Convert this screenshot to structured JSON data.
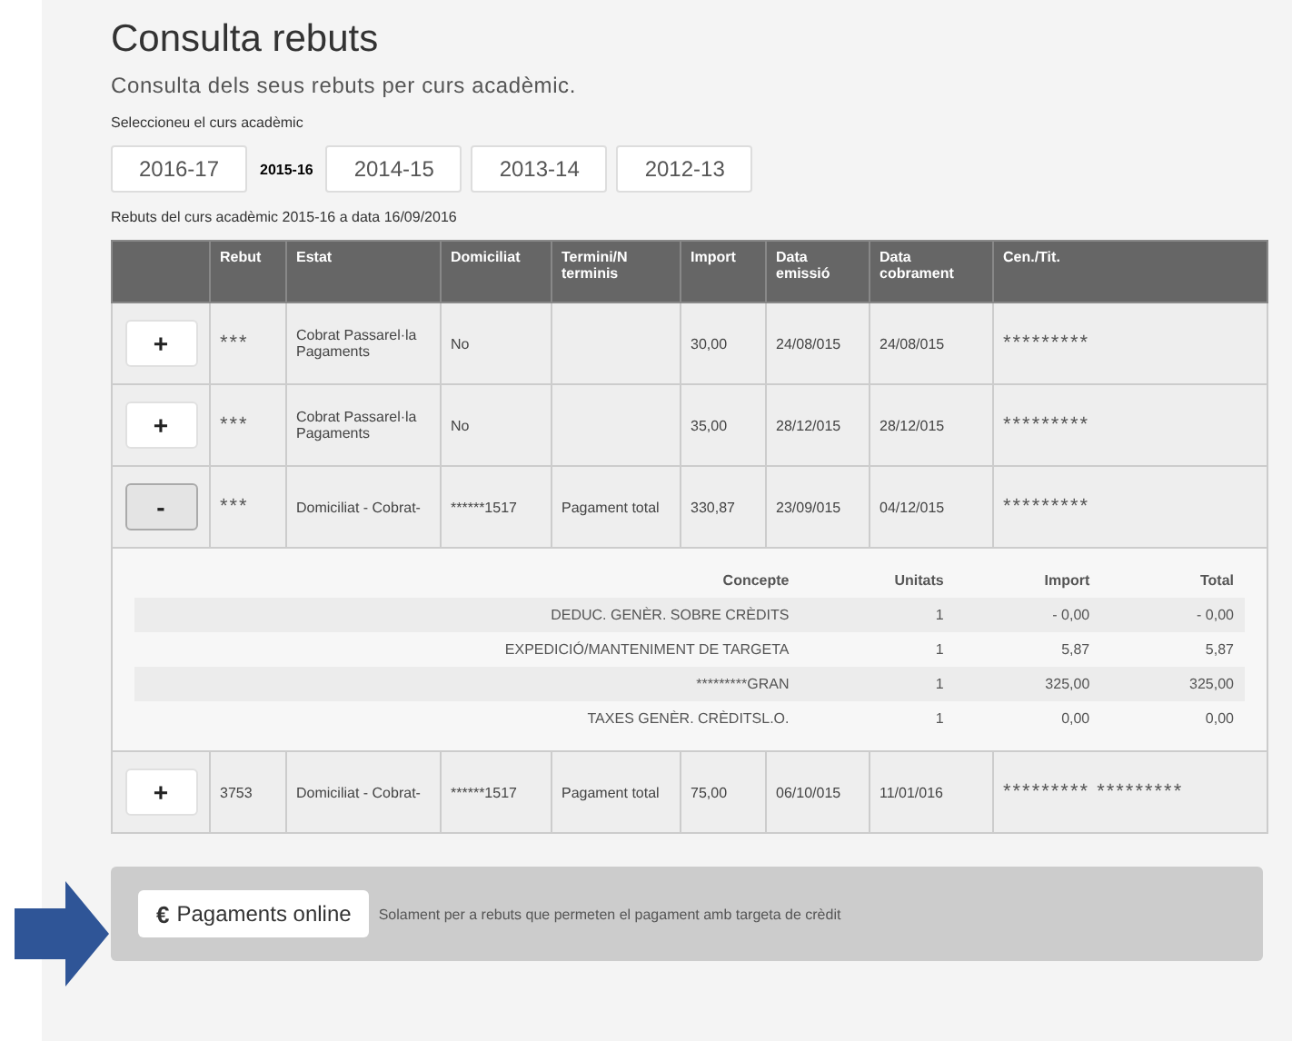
{
  "title": "Consulta rebuts",
  "subtitle": "Consulta dels seus rebuts per curs acadèmic.",
  "year_label": "Seleccioneu el curs acadèmic",
  "years": [
    {
      "label": "2016-17",
      "selected": false
    },
    {
      "label": "2015-16",
      "selected": true
    },
    {
      "label": "2014-15",
      "selected": false
    },
    {
      "label": "2013-14",
      "selected": false
    },
    {
      "label": "2012-13",
      "selected": false
    }
  ],
  "caption": "Rebuts del curs acadèmic 2015-16 a data 16/09/2016",
  "table": {
    "columns": [
      "Rebut",
      "Estat",
      "Domiciliat",
      "Termini/N terminis",
      "Import",
      "Data emissió",
      "Data cobrament",
      "Cen./Tit."
    ],
    "rows": [
      {
        "toggle": "+",
        "expanded": false,
        "cells": [
          "***",
          "Cobrat Passarel·la Pagaments",
          "No",
          "",
          "30,00",
          "24/08/015",
          "24/08/015",
          "*********"
        ]
      },
      {
        "toggle": "+",
        "expanded": false,
        "cells": [
          "***",
          "Cobrat Passarel·la Pagaments",
          "No",
          "",
          "35,00",
          "28/12/015",
          "28/12/015",
          "*********"
        ]
      },
      {
        "toggle": "-",
        "expanded": true,
        "cells": [
          "***",
          "Domiciliat - Cobrat-",
          "******1517",
          "Pagament total",
          "330,87",
          "23/09/015",
          "04/12/015",
          "*********"
        ],
        "detail": {
          "columns": [
            "Concepte",
            "Unitats",
            "Import",
            "Total"
          ],
          "rows": [
            [
              "DEDUC. GENÈR. SOBRE CRÈDITS",
              "1",
              "- 0,00",
              "- 0,00"
            ],
            [
              "EXPEDICIÓ/MANTENIMENT DE TARGETA",
              "1",
              "5,87",
              "5,87"
            ],
            [
              "*********GRAN",
              "1",
              "325,00",
              "325,00"
            ],
            [
              "TAXES GENÈR. CRÈDITSL.O.",
              "1",
              "0,00",
              "0,00"
            ]
          ]
        }
      },
      {
        "toggle": "+",
        "expanded": false,
        "cells": [
          "3753",
          "Domiciliat - Cobrat-",
          "******1517",
          "Pagament total",
          "75,00",
          "06/10/015",
          "11/01/016",
          "********* *********"
        ]
      }
    ]
  },
  "online": {
    "icon": "€",
    "button": "Pagaments online",
    "note": "Solament per a rebuts que permeten el pagament amb targeta de crèdit"
  }
}
